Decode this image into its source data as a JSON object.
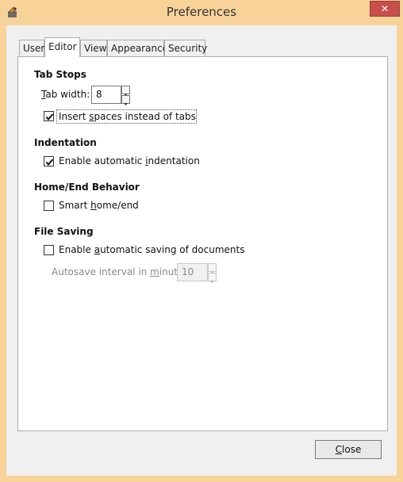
{
  "window": {
    "title": "Preferences",
    "close_button_glyph": "✕"
  },
  "tabs": [
    {
      "label": "User",
      "selected": false
    },
    {
      "label": "Editor",
      "selected": true
    },
    {
      "label": "View",
      "selected": false
    },
    {
      "label": "Appearance",
      "selected": false
    },
    {
      "label": "Security",
      "selected": false
    }
  ],
  "tab_stops": {
    "heading": "Tab Stops",
    "tab_width_label_first": "T",
    "tab_width_label_rest": "ab width:",
    "tab_width_value": "8",
    "insert_spaces_label_pre": "Insert ",
    "insert_spaces_label_u": "s",
    "insert_spaces_label_post": "paces instead of tabs",
    "insert_spaces_checked": true
  },
  "indentation": {
    "heading": "Indentation",
    "auto_indent_label_pre": "Enable automatic ",
    "auto_indent_label_u": "i",
    "auto_indent_label_post": "ndentation",
    "auto_indent_checked": true
  },
  "home_end": {
    "heading": "Home/End Behavior",
    "smart_label_pre": "Smart ",
    "smart_label_u": "h",
    "smart_label_post": "ome/end",
    "smart_checked": false
  },
  "file_saving": {
    "heading": "File Saving",
    "autosave_label_pre": "Enable ",
    "autosave_label_u": "a",
    "autosave_label_post": "utomatic saving of documents",
    "autosave_checked": false,
    "interval_label_pre": "Autosave interval in ",
    "interval_label_u": "m",
    "interval_label_post": "inutes:",
    "interval_value": "10"
  },
  "footer": {
    "close_label_u": "C",
    "close_label_rest": "lose"
  },
  "colors": {
    "title_bar": "#f7d39a",
    "close_button": "#c7504c"
  }
}
